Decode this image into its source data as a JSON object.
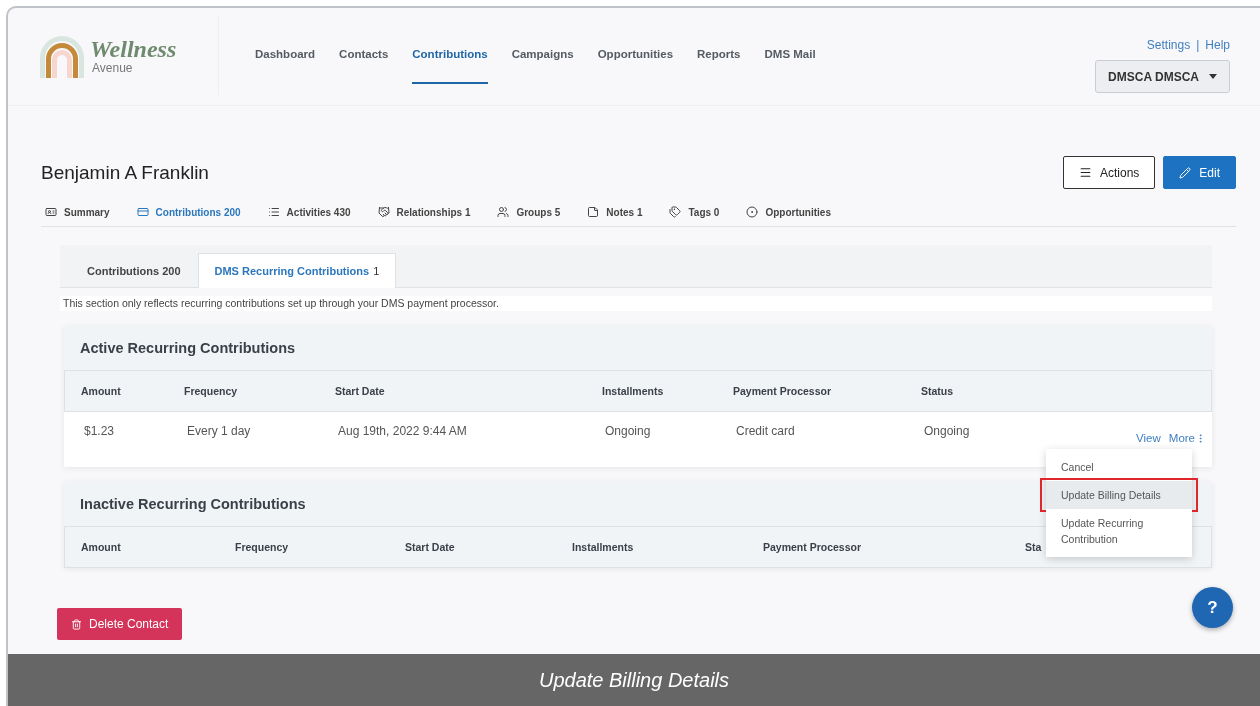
{
  "logo": {
    "name": "Wellness",
    "tagline": "Avenue"
  },
  "nav": [
    {
      "label": "Dashboard",
      "selected": false
    },
    {
      "label": "Contacts",
      "selected": false
    },
    {
      "label": "Contributions",
      "selected": true
    },
    {
      "label": "Campaigns",
      "selected": false
    },
    {
      "label": "Opportunities",
      "selected": false
    },
    {
      "label": "Reports",
      "selected": false
    },
    {
      "label": "DMS Mail",
      "selected": false
    }
  ],
  "top_links": [
    "Settings",
    "|",
    "Help"
  ],
  "user_menu": {
    "label": "DMSCA DMSCA"
  },
  "contact": {
    "name": "Benjamin A Franklin",
    "actions": [
      "Actions",
      "Edit"
    ]
  },
  "subnav": [
    {
      "label": "Summary",
      "selected": false
    },
    {
      "label": "Contributions 200",
      "selected": true
    },
    {
      "label": "Activities 430",
      "selected": false
    },
    {
      "label": "Relationships 1",
      "selected": false
    },
    {
      "label": "Groups 5",
      "selected": false
    },
    {
      "label": "Notes 1",
      "selected": false
    },
    {
      "label": "Tags 0",
      "selected": false
    },
    {
      "label": "Opportunities",
      "selected": false
    }
  ],
  "tabs": [
    {
      "label": "Contributions 200",
      "selected": false
    },
    {
      "label": "DMS Recurring Contributions",
      "count": "1",
      "selected": true
    }
  ],
  "notice": "This section only reflects recurring contributions set up through your DMS payment processor.",
  "active": {
    "title": "Active Recurring Contributions",
    "columns": [
      "Amount",
      "Frequency",
      "Start Date",
      "Installments",
      "Payment Processor",
      "Status"
    ],
    "rows": [
      {
        "cells": [
          "$1.23",
          "Every 1 day",
          "Aug 19th, 2022 9:44 AM",
          "Ongoing",
          "Credit card",
          "Ongoing"
        ],
        "links": [
          "View",
          "More"
        ]
      }
    ]
  },
  "inactive": {
    "title": "Inactive Recurring Contributions",
    "columns": [
      "Amount",
      "Frequency",
      "Start Date",
      "Installments",
      "Payment Processor",
      "Sta"
    ]
  },
  "row_menu": [
    {
      "label": "Cancel",
      "selected": false
    },
    {
      "label": "Update Billing Details",
      "selected": true
    },
    {
      "label": "Update Recurring Contribution",
      "selected": false
    }
  ],
  "delete_button": "Delete Contact",
  "help_button": "?",
  "caption": "Update Billing Details"
}
